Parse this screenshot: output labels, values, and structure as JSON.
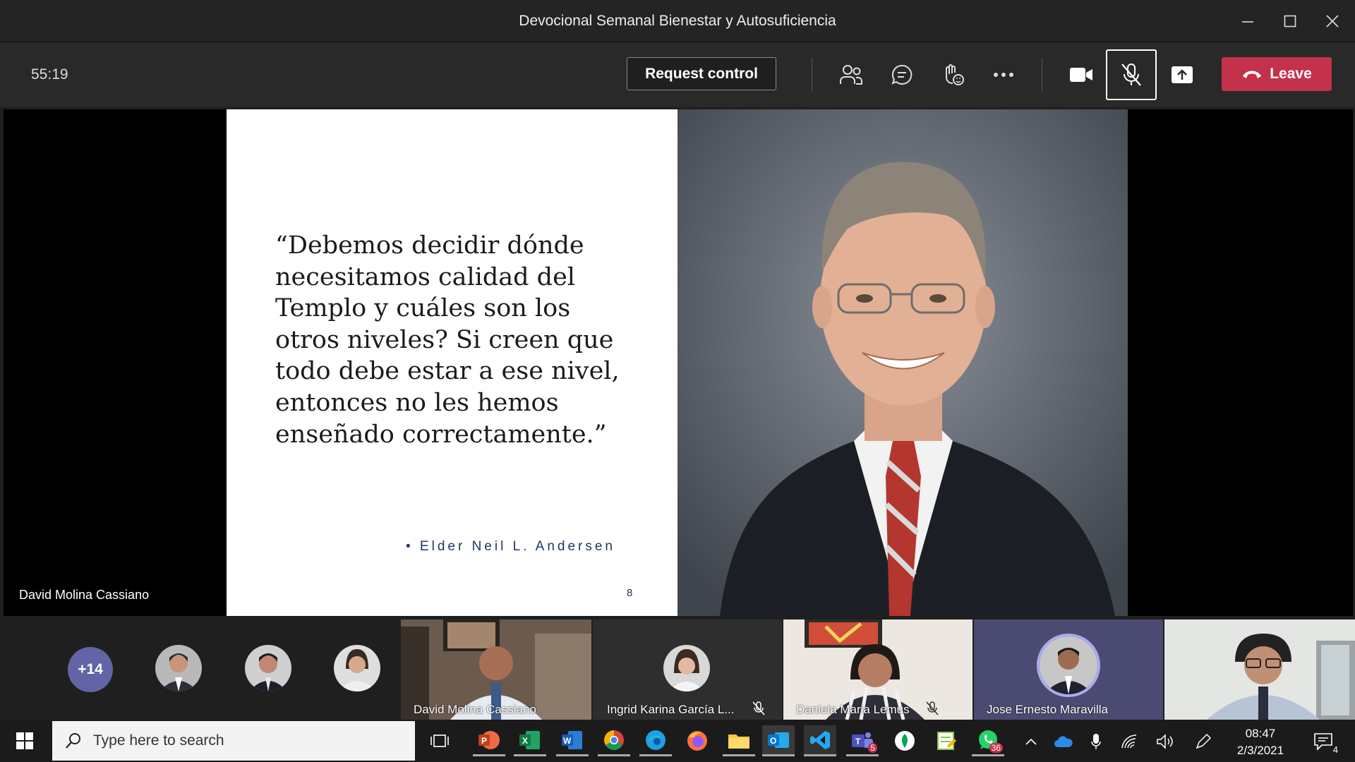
{
  "window": {
    "title": "Devocional Semanal Bienestar y Autosuficiencia"
  },
  "toolbar": {
    "timer": "55:19",
    "request_control": "Request control",
    "leave_label": "Leave",
    "icons": [
      "people-icon",
      "chat-icon",
      "reactions-icon",
      "more-icon",
      "camera-icon",
      "mic-off-icon",
      "share-icon"
    ]
  },
  "slide": {
    "quote": "“Debemos decidir dónde\nnecesitamos calidad del\nTemplo y cuáles son los\notros niveles? Si creen que\ntodo debe estar a ese nivel,\nentonces no les hemos\nenseñado correctamente.”",
    "author": "• Elder Neil L. Andersen",
    "page_number": "8"
  },
  "stage": {
    "presenter_name": "David Molina Cassiano"
  },
  "participants": {
    "more_count": "+14",
    "tiles": [
      {
        "name": "David Molina Cassiano",
        "muted": false
      },
      {
        "name": "Ingrid Karina García L...",
        "muted": true
      },
      {
        "name": "Daniela Maria Lemus",
        "muted": true
      },
      {
        "name": "Jose Ernesto Maravilla",
        "muted": false
      },
      {
        "name": "",
        "muted": false
      }
    ]
  },
  "taskbar": {
    "search_placeholder": "Type here to search",
    "teams_badge": "5",
    "whatsapp_badge": "36",
    "time": "08:47",
    "date": "2/3/2021",
    "notification_count": "4"
  },
  "colors": {
    "leave": "#c4314b",
    "teams_purple": "#6264a7",
    "toolbar": "#292929"
  }
}
